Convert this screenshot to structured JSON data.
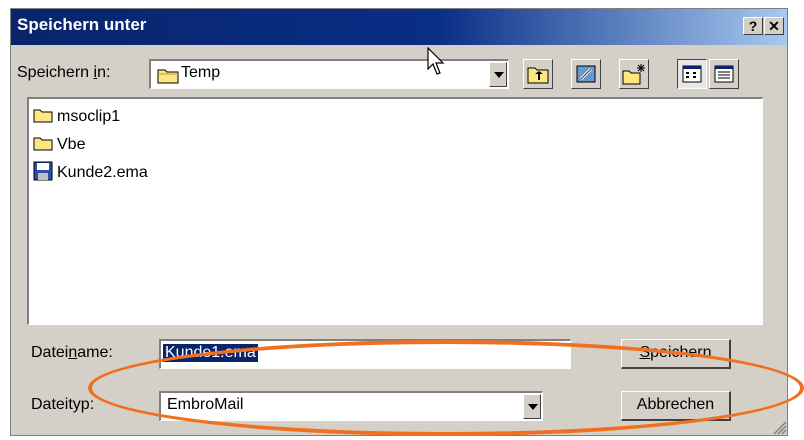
{
  "window": {
    "title": "Speichern unter",
    "help_label": "?",
    "close_label": "✕"
  },
  "save_in": {
    "label_pre": "Speichern ",
    "label_key": "i",
    "label_post": "n:",
    "value": "Temp",
    "icon": "folder-icon"
  },
  "toolbar": {
    "icons": [
      "up-one-level-icon",
      "desktop-icon",
      "new-folder-icon",
      "list-view-icon",
      "details-view-icon"
    ]
  },
  "files": [
    {
      "name": "msoclip1",
      "icon": "folder-icon"
    },
    {
      "name": "Vbe",
      "icon": "folder-icon"
    },
    {
      "name": "Kunde2.ema",
      "icon": "document-icon"
    }
  ],
  "filename": {
    "label_pre": "Datei",
    "label_key": "n",
    "label_post": "ame:",
    "value": "Kunde1.ema"
  },
  "filetype": {
    "label": "Dateityp:",
    "value": "EmbroMail"
  },
  "buttons": {
    "save_key": "S",
    "save_rest": "peichern",
    "cancel": "Abbrechen"
  },
  "colors": {
    "titlebar": "#0a246a",
    "highlight_ellipse": "#f07020",
    "dialog_face": "#d4d0c8"
  }
}
